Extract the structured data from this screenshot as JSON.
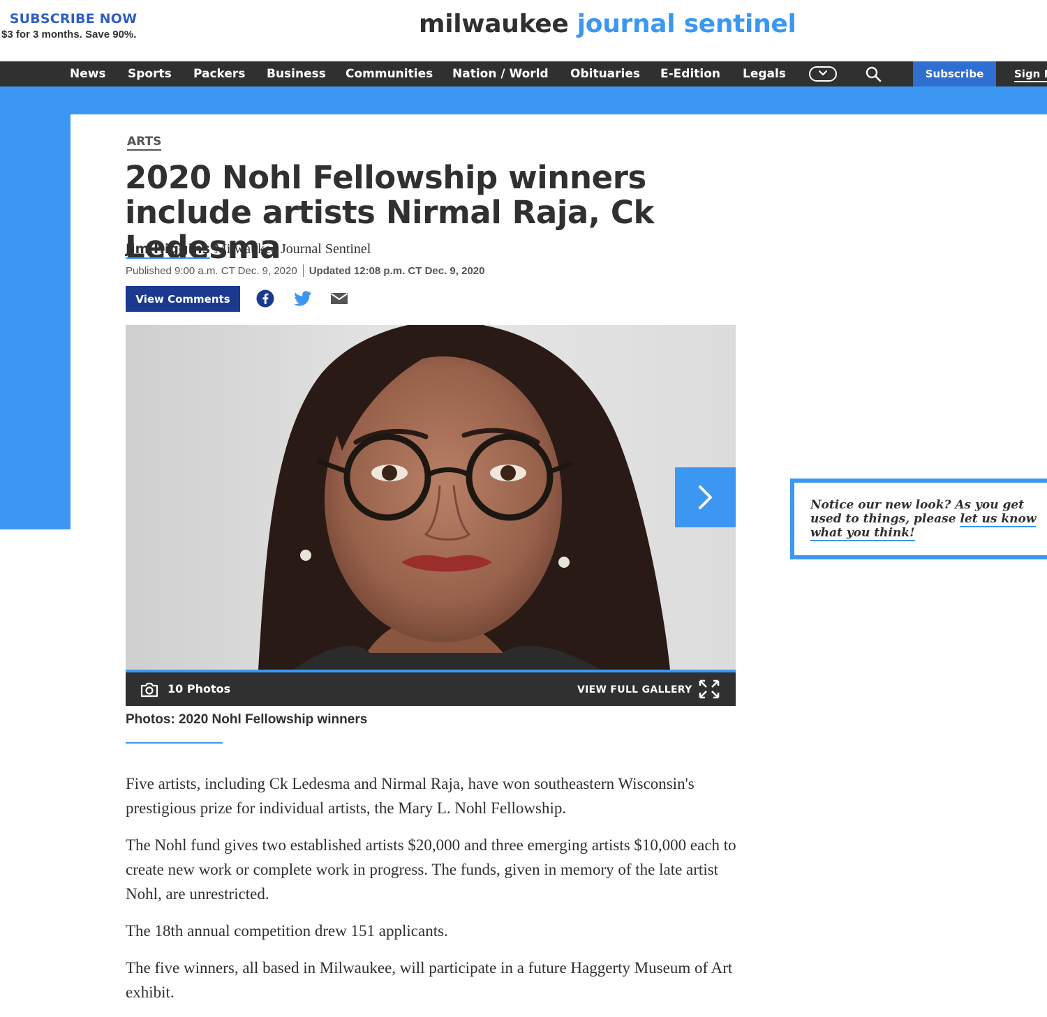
{
  "header": {
    "subscribe_label": "SUBSCRIBE NOW",
    "subscribe_offer": "$3 for 3 months. Save 90%.",
    "logo_part1": "milwaukee",
    "logo_part2": "journal sentinel"
  },
  "nav": {
    "items": [
      "News",
      "Sports",
      "Packers",
      "Business",
      "Communities",
      "Nation / World",
      "Obituaries",
      "E-Edition",
      "Legals"
    ],
    "more_icon": "chevron-down-icon",
    "search_icon": "search-icon",
    "subscribe_label": "Subscribe",
    "signin_label": "Sign In"
  },
  "article": {
    "section": "ARTS",
    "headline": "2020 Nohl Fellowship winners include artists Nirmal Raja, Ck Ledesma",
    "author": "Jim Higgins",
    "publication": "Milwaukee Journal Sentinel",
    "published": "Published 9:00 a.m. CT Dec. 9, 2020",
    "updated": "Updated 12:08 p.m. CT Dec. 9, 2020",
    "view_comments_label": "View Comments",
    "share_icons": [
      "facebook-icon",
      "twitter-icon",
      "email-icon"
    ],
    "paragraphs": [
      "Five artists, including Ck Ledesma and Nirmal Raja, have won southeastern Wisconsin's prestigious prize for individual artists, the Mary L. Nohl Fellowship.",
      "The Nohl fund gives two established artists $20,000 and three emerging artists $10,000 each to create new work or complete work in progress. The funds, given in memory of the late artist Nohl, are unrestricted.",
      "The 18th annual competition drew 151 applicants.",
      "The five winners, all based in Milwaukee, will participate in a future Haggerty Museum of Art exhibit."
    ]
  },
  "gallery": {
    "photo_count": "10 Photos",
    "view_full_label": "VIEW FULL GALLERY",
    "caption": "Photos: 2020 Nohl Fellowship winners",
    "next_icon": "chevron-right-icon",
    "expand_icon": "expand-icon",
    "camera_icon": "camera-icon"
  },
  "feedback": {
    "text": "Notice our new look? As you get used to things, please ",
    "link": "let us know what you think!"
  },
  "colors": {
    "brand_blue": "#3c97f3",
    "dark_bar": "#303030",
    "button_navy": "#1b3a8f",
    "subscribe_blue": "#2f6fd1"
  }
}
